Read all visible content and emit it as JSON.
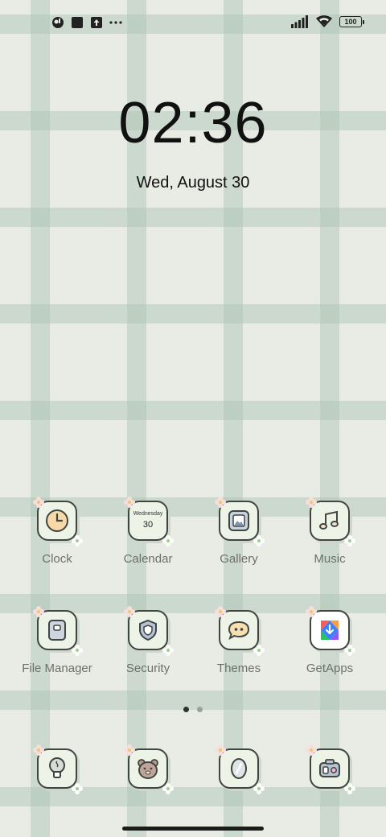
{
  "status_bar": {
    "left_icons": [
      "app-notification-icon",
      "square-notification-icon",
      "upload-icon",
      "more-dots-icon"
    ],
    "right_icons": [
      "signal-icon",
      "wifi-icon",
      "battery-icon"
    ],
    "battery_level": "100"
  },
  "lockclock": {
    "time": "02:36",
    "date": "Wed, August 30"
  },
  "apps_row1": [
    {
      "label": "Clock",
      "icon": "clock-icon"
    },
    {
      "label": "Calendar",
      "icon": "calendar-icon",
      "weekday": "Wednesday",
      "day": "30"
    },
    {
      "label": "Gallery",
      "icon": "gallery-icon"
    },
    {
      "label": "Music",
      "icon": "music-icon"
    }
  ],
  "apps_row2": [
    {
      "label": "File Manager",
      "icon": "file-manager-icon"
    },
    {
      "label": "Security",
      "icon": "security-shield-icon"
    },
    {
      "label": "Themes",
      "icon": "themes-chat-icon"
    },
    {
      "label": "GetApps",
      "icon": "getapps-icon"
    }
  ],
  "dock": [
    {
      "icon": "bulb-icon"
    },
    {
      "icon": "bear-icon"
    },
    {
      "icon": "mirror-icon"
    },
    {
      "icon": "camera-icon"
    }
  ],
  "page_indicator": {
    "pages": 2,
    "current": 1
  },
  "colors": {
    "wallpaper": "#e9ebe5",
    "gingham": "#aac3b2",
    "tile": "#eef3e8",
    "tile_border": "#3f4640",
    "label": "#6d6f6c"
  }
}
